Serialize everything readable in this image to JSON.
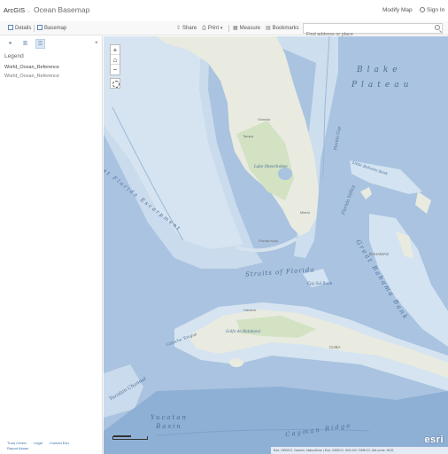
{
  "header": {
    "brand": "ArcGIS",
    "map_title": "Ocean Basemap",
    "modify_map": "Modify Map",
    "sign_in": "Sign In"
  },
  "toolbar": {
    "tabs": [
      {
        "label": "Details",
        "icon": "details-icon"
      },
      {
        "label": "Basemap",
        "icon": "basemap-icon"
      }
    ],
    "share": "Share",
    "print": "Print",
    "measure": "Measure",
    "bookmarks": "Bookmarks",
    "search_placeholder": "Find address or place"
  },
  "sidebar": {
    "legend_title": "Legend",
    "layers": [
      "World_Ocean_Reference",
      "World_Ocean_Reference"
    ],
    "footer": [
      "Trust Center",
      "Legal",
      "Contact Esri",
      "Report Abuse"
    ]
  },
  "map": {
    "labels": {
      "blake": "Blake",
      "plateau": "Plateau",
      "west_florida_escarpment": "West Florida Escarpment",
      "lake_okeechobee": "Lake Okeechobee",
      "florida_keys": "Florida Keys",
      "straits_of_florida": "Straits of Florida",
      "florida_valley": "Florida Valley",
      "great_bahama_bank": "Great Bahama Bank",
      "little_bahama_bank": "Little Bahama Bank",
      "cay_sal_bank": "Cay Sal Bank",
      "bahamas": "BAHAMAS",
      "cuba": "CUBA",
      "havana": "Havana",
      "yucatan_basin": "Yucatan Basin",
      "cayman_ridge": "Cayman Ridge",
      "yucatan_channel": "Yucatan Channel",
      "golfo_de_batabano": "Golfo de Batabanó",
      "florida_gap": "Florida Gap",
      "catoche_tongue": "Catoche Tongue",
      "orlando": "Orlando",
      "tampa": "Tampa",
      "miami": "Miami"
    },
    "attribution": "Esri, GEBCO, Garmin, NaturalVue | Esri, GEBCO, IHO-IOC GEBCO, DeLorme, NGS",
    "logo": "esri"
  },
  "colors": {
    "ocean_deep": "#a9c3e0",
    "ocean_shelf": "#cfe0ee",
    "land": "#e8eadf",
    "land_green": "#cfe0c3"
  }
}
